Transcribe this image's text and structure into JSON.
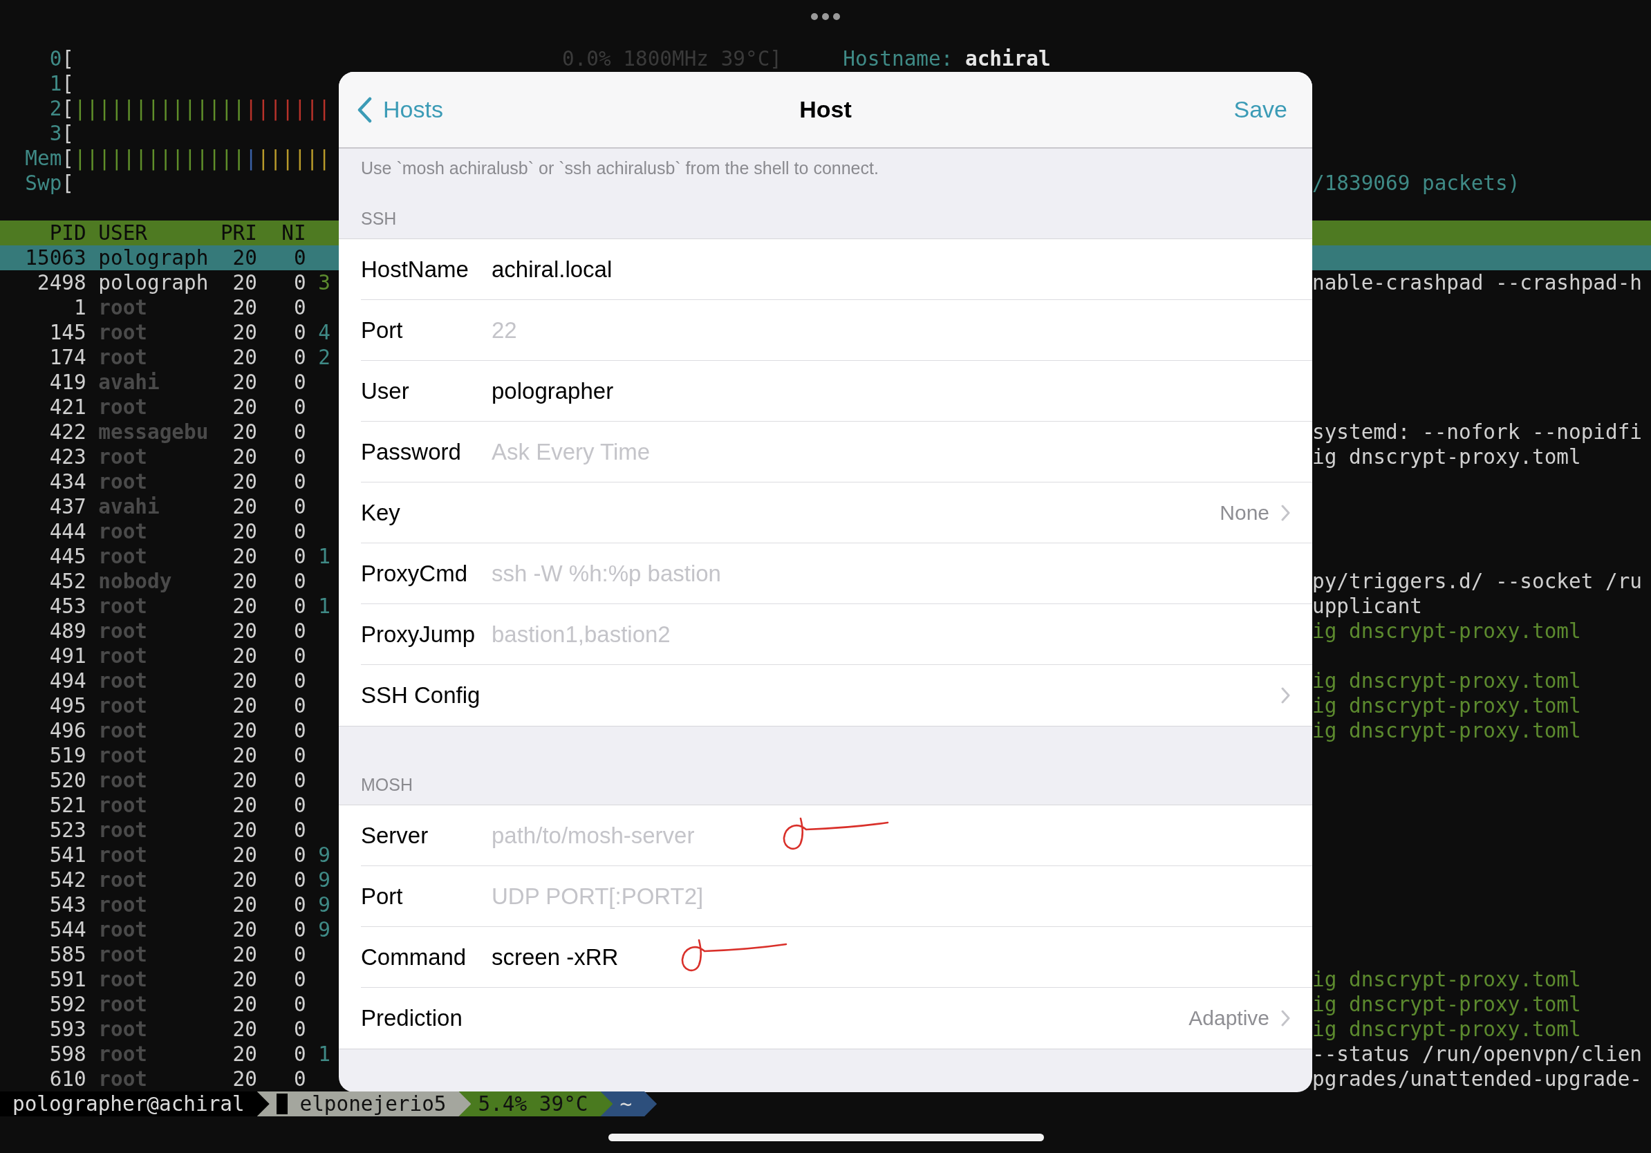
{
  "top_line": {
    "cpu_tail": "0.0% 1800MHz 39°C]",
    "hostname_label": "Hostname:",
    "hostname_value": "achiral"
  },
  "meters": [
    {
      "label": "0",
      "bracket": "["
    },
    {
      "label": "1",
      "bracket": "["
    },
    {
      "label": "2",
      "bracket": "[",
      "segments": [
        {
          "text": "||||||||||||||",
          "color": "#5f8f2a"
        },
        {
          "text": "|||||||",
          "color": "#b8322a"
        }
      ]
    },
    {
      "label": "3",
      "bracket": "["
    },
    {
      "label": "Mem",
      "bracket": "[",
      "segments": [
        {
          "text": "||||||||||||||",
          "color": "#5f8f2a"
        },
        {
          "text": "|",
          "color": "#3a62a8"
        },
        {
          "text": "||||||",
          "color": "#b89a2a"
        }
      ]
    },
    {
      "label": "Swp",
      "bracket": "[",
      "right_text": "/1839069 packets)"
    }
  ],
  "process_table": {
    "columns": [
      "PID",
      "USER",
      "PRI",
      "NI"
    ],
    "rows": [
      {
        "pid": "15063",
        "user": "polograph",
        "pri": "20",
        "ni": "0",
        "dimmed": false,
        "selected": true
      },
      {
        "pid": "2498",
        "user": "polograph",
        "pri": "20",
        "ni": "0",
        "dimmed": false,
        "selected": false,
        "column_5": "3",
        "color": "#5c8a2e",
        "command": "nable-crashpad --crashpad-h",
        "thread": false
      },
      {
        "pid": "1",
        "user": "root",
        "pri": "20",
        "ni": "0",
        "dimmed": true,
        "selected": false
      },
      {
        "pid": "145",
        "user": "root",
        "pri": "20",
        "ni": "0",
        "dimmed": true,
        "selected": false,
        "column_5": "4",
        "color": "#3f8a86"
      },
      {
        "pid": "174",
        "user": "root",
        "pri": "20",
        "ni": "0",
        "dimmed": true,
        "selected": false,
        "column_5": "2",
        "color": "#3f8a86"
      },
      {
        "pid": "419",
        "user": "avahi",
        "pri": "20",
        "ni": "0",
        "dimmed": true,
        "selected": false
      },
      {
        "pid": "421",
        "user": "root",
        "pri": "20",
        "ni": "0",
        "dimmed": true,
        "selected": false
      },
      {
        "pid": "422",
        "user": "messagebu",
        "pri": "20",
        "ni": "0",
        "dimmed": true,
        "selected": false,
        "command": "systemd: --nofork --nopidfi",
        "thread": false
      },
      {
        "pid": "423",
        "user": "root",
        "pri": "20",
        "ni": "0",
        "dimmed": true,
        "selected": false,
        "command": "ig dnscrypt-proxy.toml",
        "thread": false
      },
      {
        "pid": "434",
        "user": "root",
        "pri": "20",
        "ni": "0",
        "dimmed": true,
        "selected": false
      },
      {
        "pid": "437",
        "user": "avahi",
        "pri": "20",
        "ni": "0",
        "dimmed": true,
        "selected": false
      },
      {
        "pid": "444",
        "user": "root",
        "pri": "20",
        "ni": "0",
        "dimmed": true,
        "selected": false
      },
      {
        "pid": "445",
        "user": "root",
        "pri": "20",
        "ni": "0",
        "dimmed": true,
        "selected": false,
        "column_5": "1",
        "color": "#3f8a86"
      },
      {
        "pid": "452",
        "user": "nobody",
        "pri": "20",
        "ni": "0",
        "dimmed": true,
        "selected": false,
        "command": "py/triggers.d/ --socket /ru",
        "thread": false
      },
      {
        "pid": "453",
        "user": "root",
        "pri": "20",
        "ni": "0",
        "dimmed": true,
        "selected": false,
        "column_5": "1",
        "color": "#3f8a86",
        "command": "upplicant",
        "thread": false
      },
      {
        "pid": "489",
        "user": "root",
        "pri": "20",
        "ni": "0",
        "dimmed": true,
        "selected": false,
        "command": "ig dnscrypt-proxy.toml",
        "thread": true
      },
      {
        "pid": "491",
        "user": "root",
        "pri": "20",
        "ni": "0",
        "dimmed": true,
        "selected": false
      },
      {
        "pid": "494",
        "user": "root",
        "pri": "20",
        "ni": "0",
        "dimmed": true,
        "selected": false,
        "command": "ig dnscrypt-proxy.toml",
        "thread": true
      },
      {
        "pid": "495",
        "user": "root",
        "pri": "20",
        "ni": "0",
        "dimmed": true,
        "selected": false,
        "command": "ig dnscrypt-proxy.toml",
        "thread": true
      },
      {
        "pid": "496",
        "user": "root",
        "pri": "20",
        "ni": "0",
        "dimmed": true,
        "selected": false,
        "command": "ig dnscrypt-proxy.toml",
        "thread": true
      },
      {
        "pid": "519",
        "user": "root",
        "pri": "20",
        "ni": "0",
        "dimmed": true,
        "selected": false
      },
      {
        "pid": "520",
        "user": "root",
        "pri": "20",
        "ni": "0",
        "dimmed": true,
        "selected": false
      },
      {
        "pid": "521",
        "user": "root",
        "pri": "20",
        "ni": "0",
        "dimmed": true,
        "selected": false
      },
      {
        "pid": "523",
        "user": "root",
        "pri": "20",
        "ni": "0",
        "dimmed": true,
        "selected": false
      },
      {
        "pid": "541",
        "user": "root",
        "pri": "20",
        "ni": "0",
        "dimmed": true,
        "selected": false,
        "column_5": "9",
        "color": "#3f8a86"
      },
      {
        "pid": "542",
        "user": "root",
        "pri": "20",
        "ni": "0",
        "dimmed": true,
        "selected": false,
        "column_5": "9",
        "color": "#3f8a86"
      },
      {
        "pid": "543",
        "user": "root",
        "pri": "20",
        "ni": "0",
        "dimmed": true,
        "selected": false,
        "column_5": "9",
        "color": "#3f8a86"
      },
      {
        "pid": "544",
        "user": "root",
        "pri": "20",
        "ni": "0",
        "dimmed": true,
        "selected": false,
        "column_5": "9",
        "color": "#3f8a86"
      },
      {
        "pid": "585",
        "user": "root",
        "pri": "20",
        "ni": "0",
        "dimmed": true,
        "selected": false
      },
      {
        "pid": "591",
        "user": "root",
        "pri": "20",
        "ni": "0",
        "dimmed": true,
        "selected": false,
        "command": "ig dnscrypt-proxy.toml",
        "thread": true
      },
      {
        "pid": "592",
        "user": "root",
        "pri": "20",
        "ni": "0",
        "dimmed": true,
        "selected": false,
        "command": "ig dnscrypt-proxy.toml",
        "thread": true
      },
      {
        "pid": "593",
        "user": "root",
        "pri": "20",
        "ni": "0",
        "dimmed": true,
        "selected": false,
        "command": "ig dnscrypt-proxy.toml",
        "thread": true
      },
      {
        "pid": "598",
        "user": "root",
        "pri": "20",
        "ni": "0",
        "dimmed": true,
        "selected": false,
        "column_5": "1",
        "color": "#3f8a86",
        "command": "--status /run/openvpn/clien",
        "thread": false
      },
      {
        "pid": "610",
        "user": "root",
        "pri": "20",
        "ni": "0",
        "dimmed": true,
        "selected": false,
        "command": "pgrades/unattended-upgrade-",
        "thread": false
      }
    ]
  },
  "status_bar": [
    {
      "text": "polographer@achiral",
      "color": "#000000",
      "cursor": false
    },
    {
      "text": "elponejerio5",
      "color": "#a4a69e",
      "cursor": true
    },
    {
      "text": "5.4% 39°C",
      "color": "#4a7a1f",
      "cursor": false
    },
    {
      "text": "~",
      "color": "#2d4f7c",
      "cursor": false
    }
  ],
  "dialog": {
    "back": "Hosts",
    "title": "Host",
    "save": "Save",
    "note": "Use `mosh achiralusb` or `ssh achiralusb` from the shell to connect.",
    "sections": [
      {
        "header": "SSH",
        "rows": [
          {
            "kind": "input",
            "label": "HostName",
            "value": "achiral.local",
            "annotated": false
          },
          {
            "kind": "input",
            "label": "Port",
            "placeholder": "22",
            "annotated": false
          },
          {
            "kind": "input",
            "label": "User",
            "value": "polographer",
            "annotated": false
          },
          {
            "kind": "input",
            "label": "Password",
            "placeholder": "Ask Every Time",
            "annotated": false
          },
          {
            "kind": "disclosure",
            "label": "Key",
            "value": "None"
          },
          {
            "kind": "input",
            "label": "ProxyCmd",
            "placeholder": "ssh -W %h:%p bastion",
            "annotated": false
          },
          {
            "kind": "input",
            "label": "ProxyJump",
            "placeholder": "bastion1,bastion2",
            "annotated": false
          },
          {
            "kind": "disclosure",
            "label": "SSH Config"
          }
        ]
      },
      {
        "header": "MOSH",
        "rows": [
          {
            "kind": "input",
            "label": "Server",
            "placeholder": "path/to/mosh-server",
            "annotated": true
          },
          {
            "kind": "input",
            "label": "Port",
            "placeholder": "UDP PORT[:PORT2]",
            "annotated": false
          },
          {
            "kind": "input",
            "label": "Command",
            "value": "screen -xRR",
            "annotated": true
          },
          {
            "kind": "disclosure",
            "label": "Prediction",
            "value": "Adaptive"
          }
        ]
      }
    ]
  }
}
